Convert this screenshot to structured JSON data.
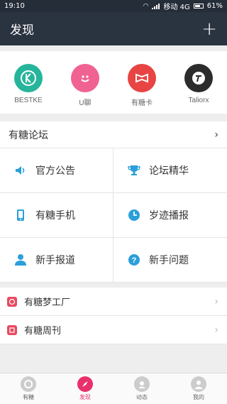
{
  "status_bar": {
    "time": "19:10",
    "carrier": "移动 4G",
    "battery": "61%"
  },
  "header": {
    "title": "发现",
    "add_label": "+"
  },
  "apps": [
    {
      "label": "BESTKE",
      "icon": "bestke-logo-icon",
      "color": "#26b59b"
    },
    {
      "label": "U聊",
      "icon": "uchat-smile-icon",
      "color": "#f06292"
    },
    {
      "label": "有糖卡",
      "icon": "card-icon",
      "color": "#e84444"
    },
    {
      "label": "Taliorx",
      "icon": "taliorx-logo-icon",
      "color": "#2c2c2c"
    }
  ],
  "forum": {
    "title": "有糖论坛",
    "items": [
      {
        "label": "官方公告",
        "icon": "speaker-icon"
      },
      {
        "label": "论坛精华",
        "icon": "trophy-icon"
      },
      {
        "label": "有糖手机",
        "icon": "phone-icon"
      },
      {
        "label": "岁迹播报",
        "icon": "clock-icon"
      },
      {
        "label": "新手报道",
        "icon": "person-icon"
      },
      {
        "label": "新手问题",
        "icon": "question-icon"
      }
    ]
  },
  "extra_links": [
    {
      "label": "有糖梦工厂",
      "icon": "dream-factory-icon"
    },
    {
      "label": "有糖周刊",
      "icon": "weekly-icon"
    }
  ],
  "tabs": [
    {
      "label": "有糖",
      "icon": "youtang-tab-icon"
    },
    {
      "label": "发现",
      "icon": "discover-tab-icon",
      "active": true
    },
    {
      "label": "动态",
      "icon": "moments-tab-icon"
    },
    {
      "label": "我的",
      "icon": "profile-tab-icon"
    }
  ],
  "colors": {
    "header_bg": "#2a3340",
    "accent": "#e8306a",
    "icon_blue": "#2b9fd9"
  }
}
